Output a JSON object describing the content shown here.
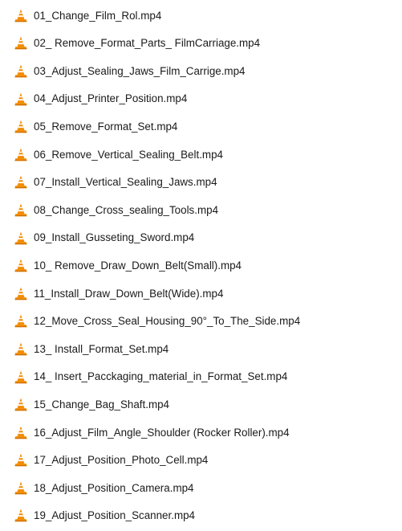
{
  "file_list": {
    "icon": "vlc-cone-icon",
    "colors": {
      "cone_orange": "#f28b00",
      "cone_stripe": "#ffffff",
      "base": "#c66a00",
      "text": "#1a1a1a"
    },
    "items": [
      {
        "name": "01_Change_Film_Rol.mp4"
      },
      {
        "name": "02_ Remove_Format_Parts_ FilmCarriage.mp4"
      },
      {
        "name": "03_Adjust_Sealing_Jaws_Film_Carrige.mp4"
      },
      {
        "name": "04_Adjust_Printer_Position.mp4"
      },
      {
        "name": "05_Remove_Format_Set.mp4"
      },
      {
        "name": "06_Remove_Vertical_Sealing_Belt.mp4"
      },
      {
        "name": "07_Install_Vertical_Sealing_Jaws.mp4"
      },
      {
        "name": "08_Change_Cross_sealing_Tools.mp4"
      },
      {
        "name": "09_Install_Gusseting_Sword.mp4"
      },
      {
        "name": "10_ Remove_Draw_Down_Belt(Small).mp4"
      },
      {
        "name": "11_Install_Draw_Down_Belt(Wide).mp4"
      },
      {
        "name": "12_Move_Cross_Seal_Housing_90°_To_The_Side.mp4"
      },
      {
        "name": "13_ Install_Format_Set.mp4"
      },
      {
        "name": "14_ Insert_Pacckaging_material_in_Format_Set.mp4"
      },
      {
        "name": "15_Change_Bag_Shaft.mp4"
      },
      {
        "name": "16_Adjust_Film_Angle_Shoulder (Rocker Roller).mp4"
      },
      {
        "name": "17_Adjust_Position_Photo_Cell.mp4"
      },
      {
        "name": "18_Adjust_Position_Camera.mp4"
      },
      {
        "name": "19_Adjust_Position_Scanner.mp4"
      }
    ]
  }
}
